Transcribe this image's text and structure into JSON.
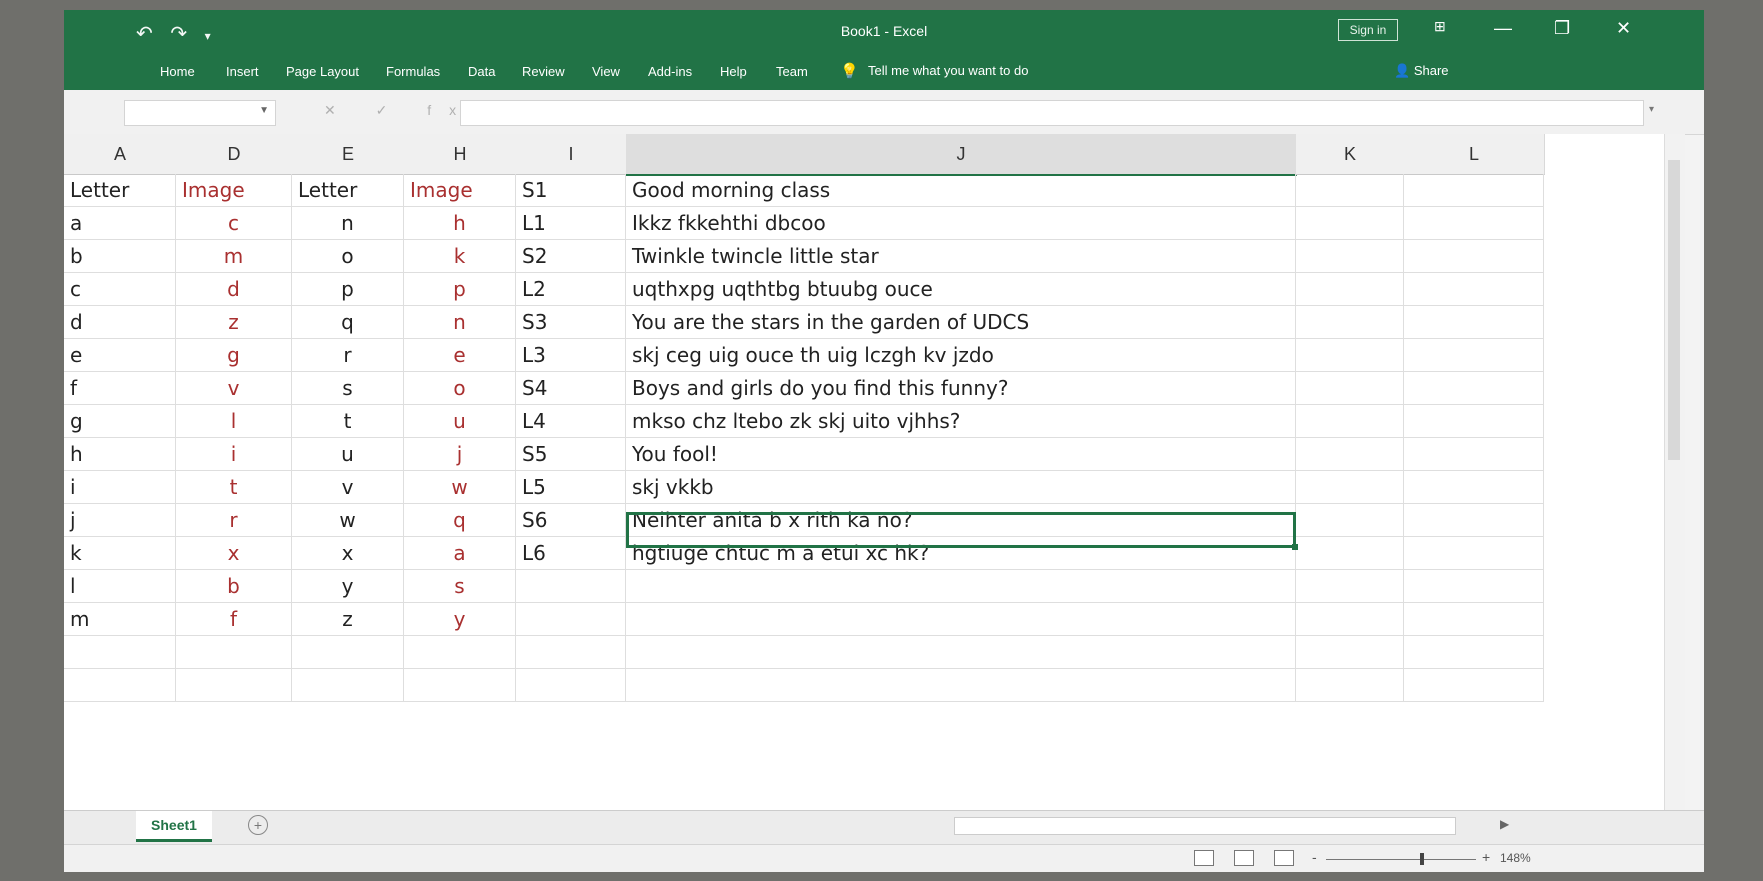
{
  "app": {
    "title": "Book1  -  Excel",
    "sign_in": "Sign in",
    "quick_access": {
      "undo": "↶",
      "redo": "↷",
      "customize": "▾"
    },
    "window_controls": {
      "minimize": "—",
      "restore": "❐",
      "close": "✕",
      "ribbon_display": "⊞"
    }
  },
  "ribbon": {
    "tabs": [
      "Home",
      "Insert",
      "Page Layout",
      "Formulas",
      "Data",
      "Review",
      "View",
      "Add-ins",
      "Help",
      "Team"
    ],
    "tell_me": "Tell me what you want to do",
    "share": "Share"
  },
  "formula_bar": {
    "name_box": "",
    "fx_symbols": "✕ ✓ fx",
    "formula": ""
  },
  "columns": [
    "A",
    "D",
    "E",
    "H",
    "I",
    "J",
    "K",
    "L"
  ],
  "rows": [
    [
      "Letter",
      "Image",
      "Letter",
      "Image",
      "S1",
      "Good morning class"
    ],
    [
      "a",
      "c",
      "n",
      "h",
      "L1",
      "Ikkz fkkehthi dbcoo"
    ],
    [
      "b",
      "m",
      "o",
      "k",
      "S2",
      "Twinkle twincle little star"
    ],
    [
      "c",
      "d",
      "p",
      "p",
      "L2",
      "uqthxpg uqthtbg btuubg ouce"
    ],
    [
      "d",
      "z",
      "q",
      "n",
      "S3",
      "You are the stars in the garden of UDCS"
    ],
    [
      "e",
      "g",
      "r",
      "e",
      "L3",
      "skj ceg uig ouce th uig lczgh kv jzdo"
    ],
    [
      "f",
      "v",
      "s",
      "o",
      "S4",
      "Boys and girls do you find this funny?"
    ],
    [
      "g",
      "l",
      "t",
      "u",
      "L4",
      "mkso chz ltebo zk skj uito vjhhs?"
    ],
    [
      "h",
      "i",
      "u",
      "j",
      "S5",
      "You fool!"
    ],
    [
      "i",
      "t",
      "v",
      "w",
      "L5",
      "skj vkkb"
    ],
    [
      "j",
      "r",
      "w",
      "q",
      "S6",
      "Neihter anita b x rith ka no?"
    ],
    [
      "k",
      "x",
      "x",
      "a",
      "L6",
      "hgtiuge chtuc m a etui xc hk?"
    ],
    [
      "l",
      "b",
      "y",
      "s",
      "",
      ""
    ],
    [
      "m",
      "f",
      "z",
      "y",
      "",
      ""
    ],
    [
      "",
      "",
      "",
      "",
      "",
      ""
    ],
    [
      "",
      "",
      "",
      "",
      "",
      ""
    ]
  ],
  "sheets": [
    "Sheet1"
  ],
  "add_sheet": "+",
  "status": {
    "zoom": "148%",
    "zoom_minus": "-",
    "zoom_plus": "+"
  },
  "colors": {
    "excel_green": "#217346",
    "image_column_text": "#a93030"
  }
}
